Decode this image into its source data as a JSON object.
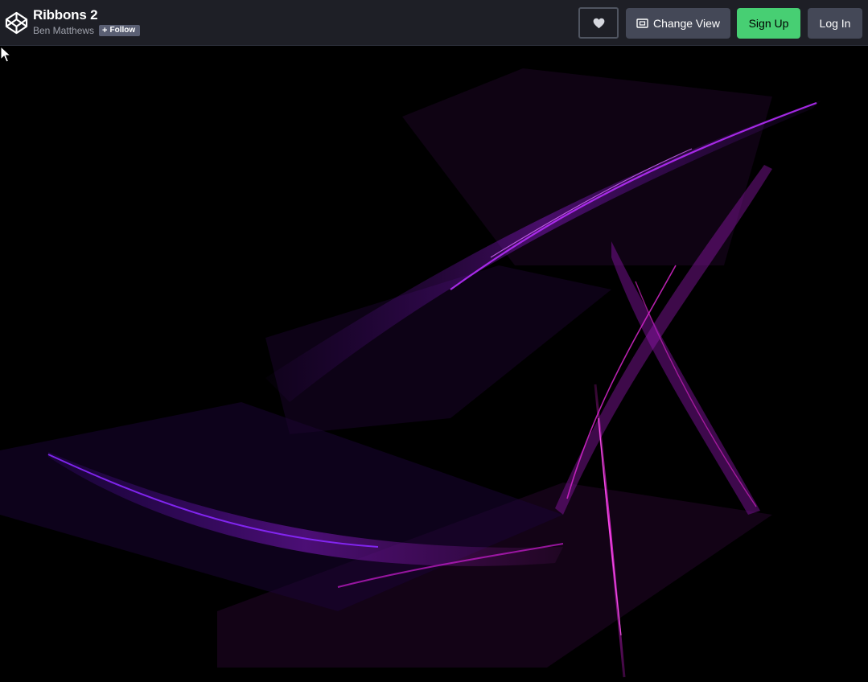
{
  "header": {
    "pen_title": "Ribbons 2",
    "author": "Ben Matthews",
    "follow_label": "Follow",
    "logo_icon": "codepen-logo-icon",
    "heart_icon": "heart-icon",
    "change_view_icon": "change-view-icon",
    "change_view_label": "Change View",
    "signup_label": "Sign Up",
    "login_label": "Log In"
  },
  "colors": {
    "topbar_bg": "#1e1f26",
    "button_bg": "#444857",
    "signup_bg": "#47cf73",
    "canvas_bg": "#000000",
    "ribbon_purple": "#9b1fe8",
    "ribbon_magenta": "#e21fd6"
  }
}
